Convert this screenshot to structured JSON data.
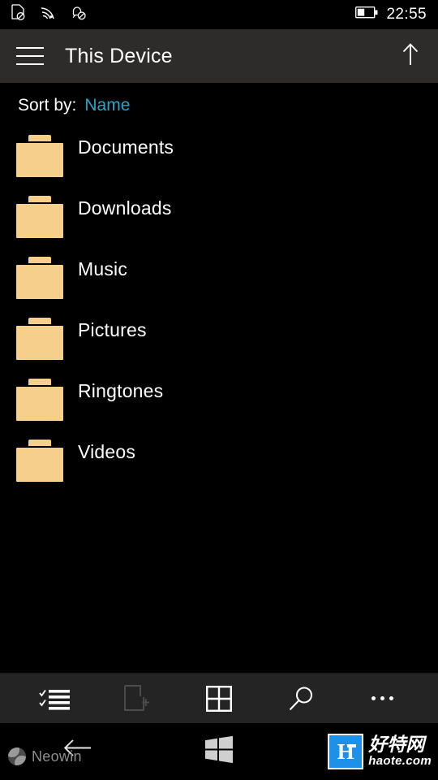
{
  "colors": {
    "background": "#000000",
    "header_bg": "#2d2c2b",
    "appbar_bg": "#252424",
    "accent": "#27a5c4",
    "folder": "#f6d08a",
    "text": "#ffffff",
    "disabled": "#4a4a4a"
  },
  "statusbar": {
    "icons": [
      {
        "name": "sim-card-missing-icon"
      },
      {
        "name": "wifi-signal-icon"
      },
      {
        "name": "notifications-off-icon"
      },
      {
        "name": "battery-icon"
      }
    ],
    "battery_level_percent": 40,
    "time": "22:55"
  },
  "header": {
    "menu_icon": "hamburger-menu-icon",
    "title": "This Device",
    "up_icon": "arrow-up-icon"
  },
  "sort": {
    "label": "Sort by:",
    "value": "Name"
  },
  "files": [
    {
      "name": "Documents",
      "icon": "folder-icon"
    },
    {
      "name": "Downloads",
      "icon": "folder-icon"
    },
    {
      "name": "Music",
      "icon": "folder-icon"
    },
    {
      "name": "Pictures",
      "icon": "folder-icon"
    },
    {
      "name": "Ringtones",
      "icon": "folder-icon"
    },
    {
      "name": "Videos",
      "icon": "folder-icon"
    }
  ],
  "appbar": {
    "buttons": [
      {
        "name": "select-checklist-icon",
        "label": "Select",
        "enabled": true
      },
      {
        "name": "new-folder-icon",
        "label": "New folder",
        "enabled": false
      },
      {
        "name": "grid-view-icon",
        "label": "Grid view",
        "enabled": true
      },
      {
        "name": "search-icon",
        "label": "Search",
        "enabled": true
      },
      {
        "name": "more-options-icon",
        "label": "More",
        "enabled": true
      }
    ]
  },
  "navbar": {
    "back_icon": "arrow-back-icon",
    "start_icon": "windows-start-icon"
  },
  "watermarks": {
    "neowin": "Neowin",
    "haote_cn": "好特网",
    "haote_en": "haote.com",
    "haote_mark": "H"
  }
}
